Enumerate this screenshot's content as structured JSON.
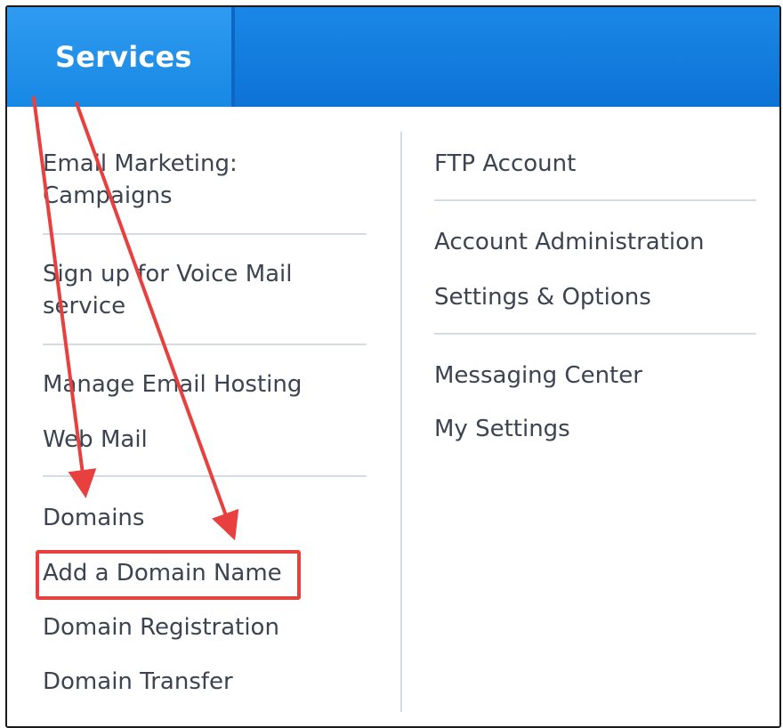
{
  "header": {
    "tab_label": "Services",
    "accent_color": "#1a87e6"
  },
  "left_column": {
    "group1": [
      "Email Marketing:",
      "Campaigns"
    ],
    "group2": [
      "Sign up for Voice Mail",
      "service"
    ],
    "group3": [
      "Manage Email Hosting",
      "Web Mail"
    ],
    "group4": [
      "Domains",
      "Add a Domain Name",
      "Domain Registration",
      "Domain Transfer"
    ]
  },
  "right_column": {
    "group1": [
      "FTP Account"
    ],
    "group2": [
      "Account Administration",
      "Settings & Options"
    ],
    "group3": [
      "Messaging Center",
      "My Settings"
    ]
  },
  "annotation": {
    "color": "#e8403f",
    "highlighted_item": "Add a Domain Name"
  }
}
